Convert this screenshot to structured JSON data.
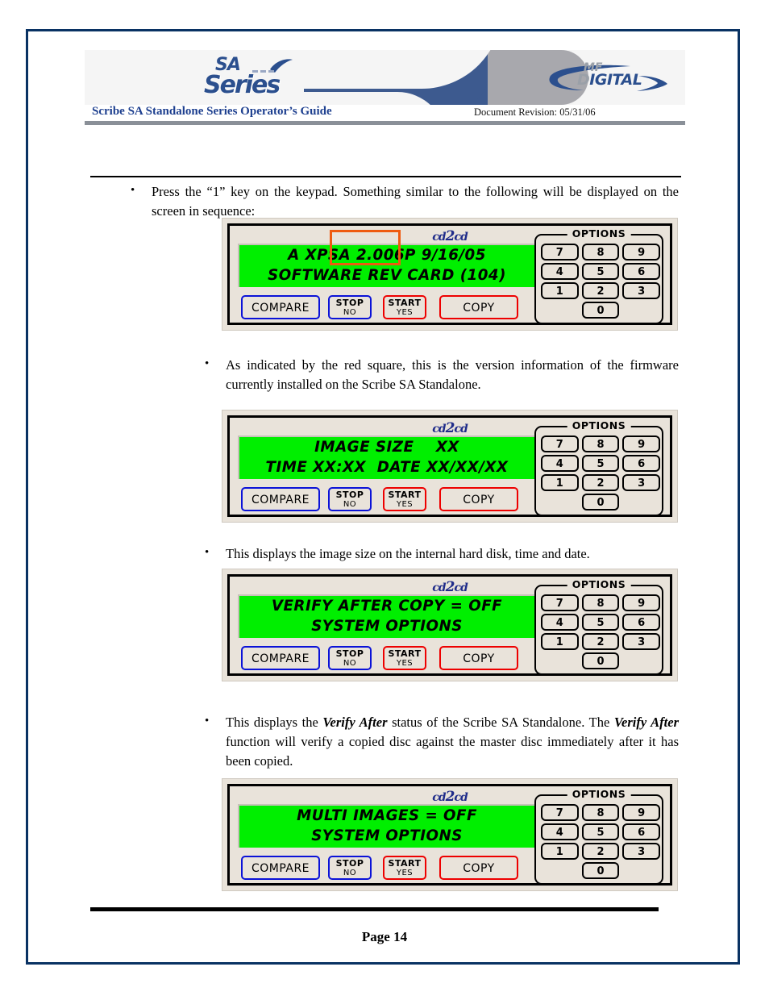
{
  "page": {
    "border_color": "#093263",
    "page_number": "Page 14"
  },
  "header": {
    "sa_logo_line1": "SA",
    "sa_logo_line2": "Series",
    "mf_logo_line1": "MF",
    "mf_logo_line2_a": "D",
    "mf_logo_line2_b": "IGITAL",
    "doc_title": "Scribe SA Standalone Series Operator’s Guide",
    "doc_revision": "Document Revision: 05/31/06"
  },
  "body": {
    "bullet1": "Press the “1” key on the keypad. Something similar to the following will be displayed on the screen in sequence:",
    "bullet2": "As indicated by the red square, this is the version information of the firmware currently installed on the Scribe SA Standalone.",
    "bullet3": "This displays the image size on the internal hard disk, time and date.",
    "bullet4_part1": "This displays the ",
    "bullet4_em1": "Verify After",
    "bullet4_part2": " status of the Scribe SA Standalone. The ",
    "bullet4_em2": "Verify After",
    "bullet4_part3": " function will verify a copied disc against the master disc immediately after it has been copied."
  },
  "device_common": {
    "brand_left": "cd",
    "brand_mid": "2",
    "brand_right": "cd",
    "keypad_legend": "OPTIONS",
    "keys": [
      "7",
      "8",
      "9",
      "4",
      "5",
      "6",
      "1",
      "2",
      "3"
    ],
    "key_zero": "0",
    "buttons": {
      "compare": "COMPARE",
      "stop_line1": "STOP",
      "stop_line2": "NO",
      "start_line1": "START",
      "start_line2": "YES",
      "copy": "COPY"
    },
    "colors": {
      "lcd_background": "#00ef00",
      "lcd_text": "#000000",
      "panel": "#e9e3da",
      "blue_button_border": "#0b12d8",
      "red_button_border": "#ee0000",
      "highlight": "#ef5b10"
    }
  },
  "devices": [
    {
      "id": "device-panel-1",
      "lcd_line1": "A XPSA 2.006P 9/16/05",
      "lcd_line2": "SOFTWARE REV CARD (104)",
      "has_highlight": true,
      "highlight_target": "2.006P"
    },
    {
      "id": "device-panel-2",
      "lcd_line1": "IMAGE SIZE    XX",
      "lcd_line2": "TIME XX:XX  DATE XX/XX/XX",
      "has_highlight": false
    },
    {
      "id": "device-panel-3",
      "lcd_line1": "VERIFY AFTER COPY = OFF",
      "lcd_line2": "SYSTEM OPTIONS",
      "has_highlight": false
    },
    {
      "id": "device-panel-4",
      "lcd_line1": "MULTI IMAGES = OFF",
      "lcd_line2": "SYSTEM OPTIONS",
      "has_highlight": false
    }
  ]
}
